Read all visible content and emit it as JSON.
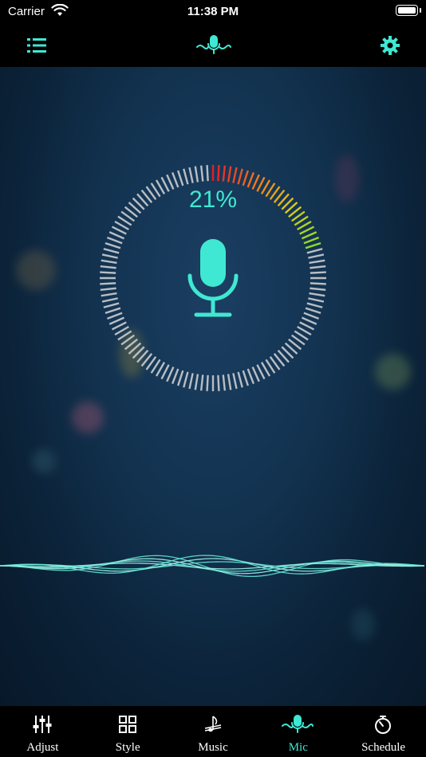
{
  "status_bar": {
    "carrier": "Carrier",
    "time": "11:38 PM"
  },
  "nav": {
    "menu_icon": "list-icon",
    "center_icon": "mic-wave-icon",
    "settings_icon": "gear-icon"
  },
  "mic": {
    "level_percent": "21%",
    "level_value": 21
  },
  "tabs": [
    {
      "label": "Adjust",
      "icon": "sliders-icon",
      "active": false
    },
    {
      "label": "Style",
      "icon": "grid-icon",
      "active": false
    },
    {
      "label": "Music",
      "icon": "music-note-icon",
      "active": false
    },
    {
      "label": "Mic",
      "icon": "mic-wave-icon",
      "active": true
    },
    {
      "label": "Schedule",
      "icon": "timer-icon",
      "active": false
    }
  ],
  "colors": {
    "accent": "#3fe8d2",
    "tab_inactive": "#ffffff",
    "tab_active": "#3fe8d2"
  }
}
